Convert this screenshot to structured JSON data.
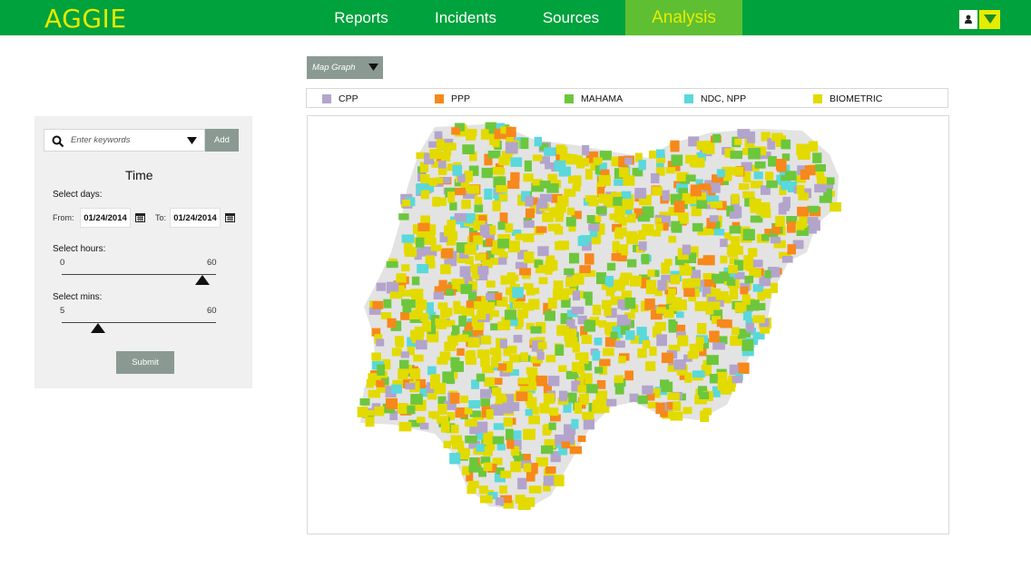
{
  "app": {
    "name": "AGGIE"
  },
  "nav": {
    "items": [
      "Reports",
      "Incidents",
      "Sources",
      "Analysis"
    ],
    "active": "Analysis"
  },
  "header_icons": [
    "user-icon",
    "chevron-down-icon"
  ],
  "search": {
    "placeholder": "Enter keywords",
    "add_label": "Add"
  },
  "time": {
    "title": "Time",
    "select_days_label": "Select days:",
    "from_label": "From:",
    "from_value": "01/24/2014",
    "to_label": "To:",
    "to_value": "01/24/2014",
    "hours": {
      "label": "Select hours:",
      "min_label": "0",
      "max_label": "60",
      "value": 60
    },
    "mins": {
      "label": "Select mins:",
      "min_label": "5",
      "max_label": "60",
      "value": 15
    },
    "submit_label": "Submit"
  },
  "view_select": {
    "selected": "Map Graph"
  },
  "legend": [
    {
      "label": "CPP",
      "color": "#b3a4cc"
    },
    {
      "label": "PPP",
      "color": "#f7881b"
    },
    {
      "label": "MAHAMA",
      "color": "#6cc73d"
    },
    {
      "label": "NDC, NPP",
      "color": "#5ad8dc"
    },
    {
      "label": "BIOMETRIC",
      "color": "#e3da00"
    }
  ],
  "colors": {
    "topbar": "#00a23d",
    "nav_active_bg": "#5fbf33",
    "accent_yellow": "#e3ea00",
    "panel_bg": "#eff0ef",
    "button_gray": "#8a9a93",
    "map_land": "#e3e3e3"
  }
}
